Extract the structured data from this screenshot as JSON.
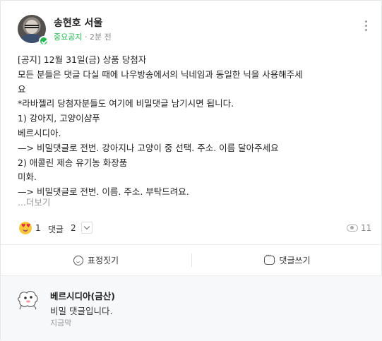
{
  "post": {
    "author": "송현호 서울",
    "role": "중요공지",
    "time": "· 2분 전",
    "lines": [
      "[공지] 12월 31일(금) 상품 당첨자",
      "모든 분들은 댓글 다실 때에 나우방송에서의 닉네임과 동일한 닉을 사용해주세",
      "요",
      "*라바젤리 당첨자분들도 여기에 비밀댓글 남기시면 됩니다.",
      "1) 강아지, 고양이샴푸",
      "베르시디아.",
      "—> 비밀댓글로 전번. 강아지나 고양이 중 선택. 주소. 이름 달아주세요",
      "2) 애콜린 제송 유기농 화장품",
      "미화.",
      "—> 비밀댓글로 전번. 이름. 주소. 부탁드려요."
    ],
    "more_label": "...더보기"
  },
  "stats": {
    "reaction_icon": "heart-eyes-emoji-icon",
    "like_count": "1",
    "comment_label": "댓글",
    "comment_count": "2",
    "view_count": "11"
  },
  "actions": {
    "emotion_label": "표정짓기",
    "comment_label": "댓글쓰기"
  },
  "comment": {
    "author": "베르시디아(금산)",
    "text": "비밀 댓글입니다.",
    "time": "지금막"
  },
  "colors": {
    "accent": "#20b74f",
    "muted": "#999999"
  }
}
